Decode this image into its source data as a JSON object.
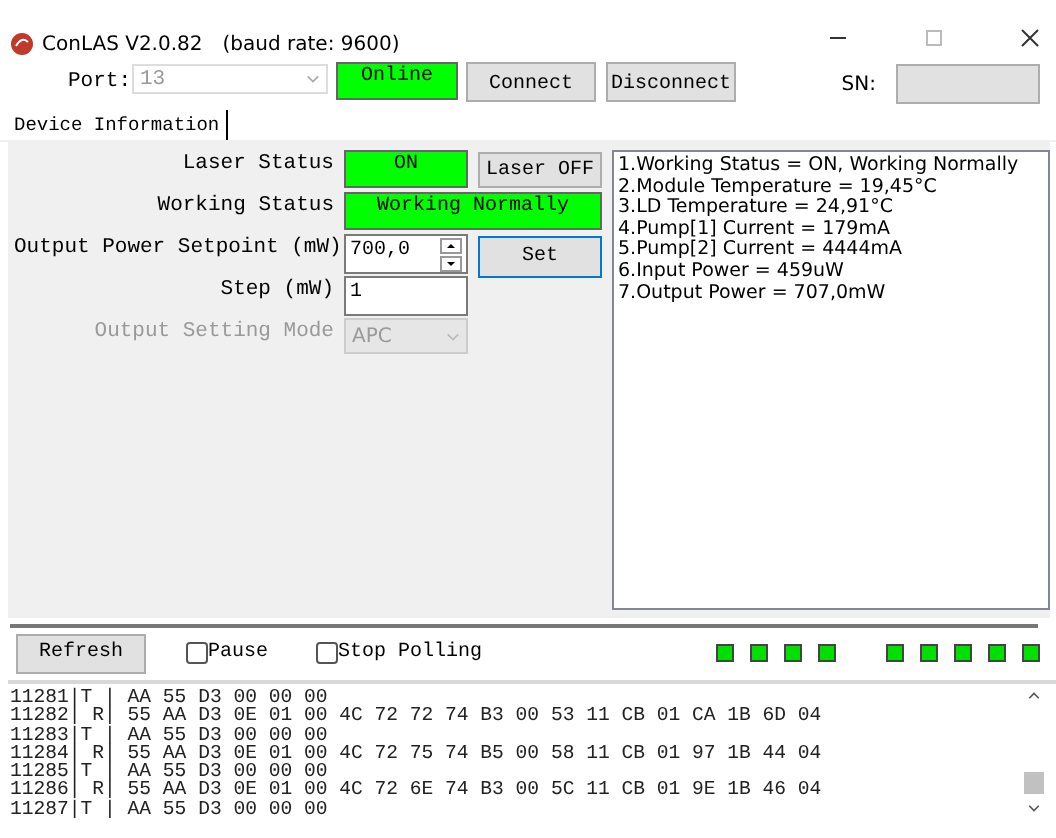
{
  "window": {
    "title": "ConLAS V2.0.82",
    "subtitle": "(baud rate: 9600)"
  },
  "toolbar": {
    "port_label": "Port:",
    "port_value": "13",
    "port_disabled": true,
    "status": "Online",
    "buttons": [
      "Connect",
      "Disconnect"
    ],
    "sn_label": "SN:"
  },
  "tabs": [
    {
      "label": "Device Information",
      "selected": true
    }
  ],
  "form": {
    "laser_status_label": "Laser Status",
    "laser_status": "ON",
    "laser_button": "Laser OFF",
    "working_status_label": "Working Status",
    "working_status": "Working Normally",
    "setpoint_label": "Output Power Setpoint (mW)",
    "setpoint": "700,0",
    "set_button": "Set",
    "step_label": "Step (mW)",
    "step": "1",
    "mode_label": "Output Setting Mode",
    "mode": "APC",
    "mode_disabled": true
  },
  "info_lines": [
    "1.Working Status  = ON, Working Normally",
    "2.Module Temperature = 19,45°C",
    "3.LD Temperature = 24,91°C",
    "4.Pump[1] Current = 179mA",
    "5.Pump[2] Current = 4444mA",
    "6.Input Power = 459uW",
    "7.Output Power = 707,0mW"
  ],
  "bottom": {
    "refresh": "Refresh",
    "checkboxes": [
      {
        "label": "Pause",
        "checked": false
      },
      {
        "label": "Stop Polling",
        "checked": false
      }
    ],
    "lamp_groups": [
      [
        {
          "on": true
        },
        {
          "on": true
        },
        {
          "on": true
        },
        {
          "on": true
        }
      ],
      [
        {
          "on": true
        },
        {
          "on": true
        },
        {
          "on": true
        },
        {
          "on": true
        },
        {
          "on": true
        }
      ]
    ]
  },
  "log": [
    "11281|T | AA 55 D3 00 00 00",
    "11282| R| 55 AA D3 0E 01 00 4C 72 72 74 B3 00 53 11 CB 01 CA 1B 6D 04",
    "11283|T | AA 55 D3 00 00 00",
    "11284| R| 55 AA D3 0E 01 00 4C 72 75 74 B5 00 58 11 CB 01 97 1B 44 04",
    "11285|T | AA 55 D3 00 00 00",
    "11286| R| 55 AA D3 0E 01 00 4C 72 6E 74 B3 00 5C 11 CB 01 9E 1B 46 04",
    "11287|T | AA 55 D3 00 00 00"
  ]
}
